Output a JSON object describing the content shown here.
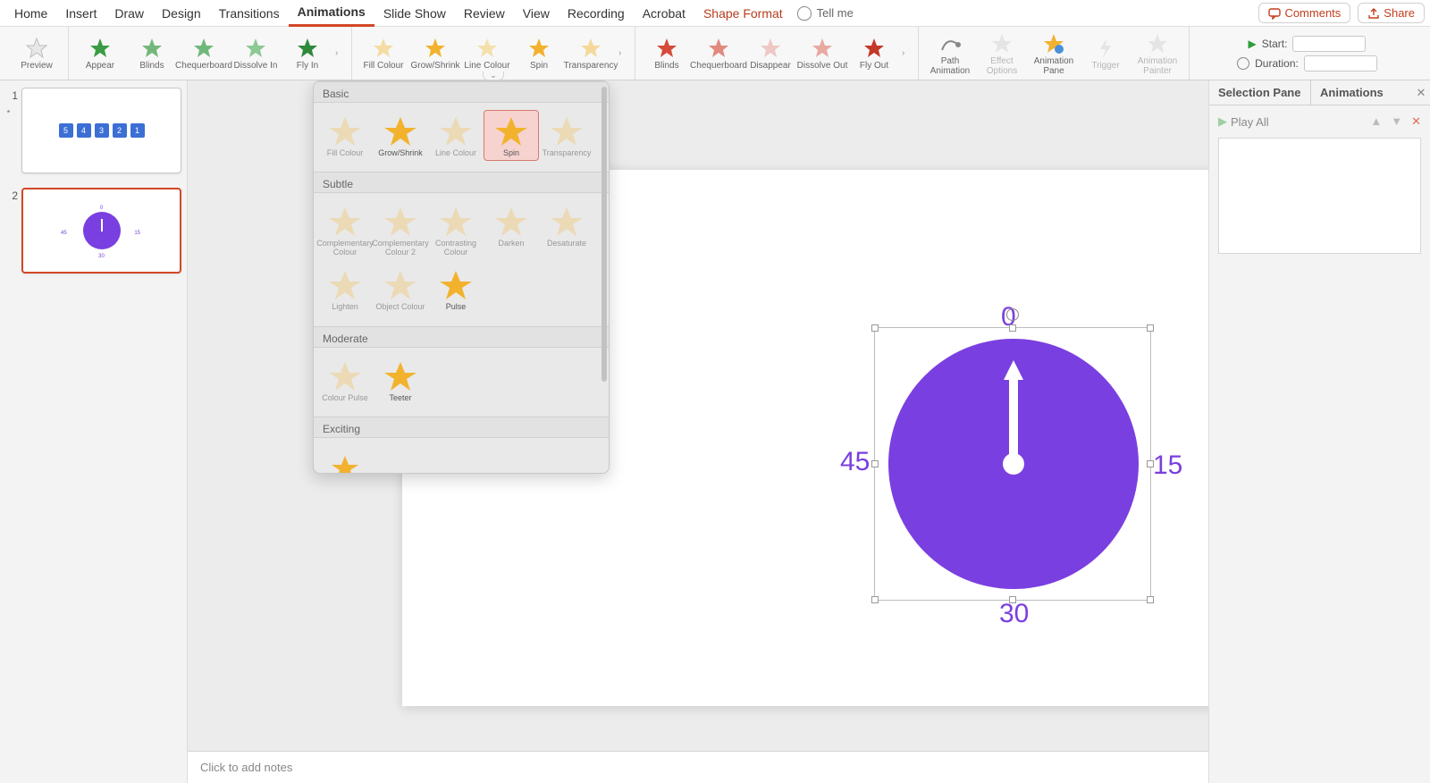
{
  "tabs": {
    "items": [
      "Home",
      "Insert",
      "Draw",
      "Design",
      "Transitions",
      "Animations",
      "Slide Show",
      "Review",
      "View",
      "Recording",
      "Acrobat"
    ],
    "active": "Animations",
    "shape": "Shape Format",
    "tellme": "Tell me",
    "comments": "Comments",
    "share": "Share"
  },
  "ribbon": {
    "preview": "Preview",
    "entrance": [
      "Appear",
      "Blinds",
      "Chequerboard",
      "Dissolve In",
      "Fly In"
    ],
    "emphasis": [
      "Fill Colour",
      "Grow/Shrink",
      "Line Colour",
      "Spin",
      "Transparency"
    ],
    "exit": [
      "Blinds",
      "Chequerboard",
      "Disappear",
      "Dissolve Out",
      "Fly Out"
    ],
    "adv": [
      {
        "l1": "Path",
        "l2": "Animation"
      },
      {
        "l1": "Effect",
        "l2": "Options"
      },
      {
        "l1": "Animation",
        "l2": "Pane"
      },
      {
        "l1": "Trigger",
        "l2": ""
      },
      {
        "l1": "Animation",
        "l2": "Painter"
      }
    ],
    "timing": {
      "start": "Start:",
      "duration": "Duration:",
      "start_val": "",
      "duration_val": ""
    }
  },
  "popover": {
    "sections": {
      "basic": "Basic",
      "subtle": "Subtle",
      "moderate": "Moderate",
      "exciting": "Exciting"
    },
    "basic": [
      "Fill Colour",
      "Grow/Shrink",
      "Line Colour",
      "Spin",
      "Transparency"
    ],
    "selected": "Spin",
    "subtle": [
      "Complementary Colour",
      "Complementary Colour 2",
      "Contrasting Colour",
      "Darken",
      "Desaturate",
      "Lighten",
      "Object Colour",
      "Pulse"
    ],
    "moderate": [
      "Colour Pulse",
      "Teeter"
    ]
  },
  "thumbs": {
    "n1": "1",
    "n2": "2",
    "slide1": [
      "5",
      "4",
      "3",
      "2",
      "1"
    ],
    "slide2": {
      "n0": "0",
      "n15": "15",
      "n30": "30",
      "n45": "45"
    },
    "ani_icon": "✦"
  },
  "canvas": {
    "clock": {
      "n0": "0",
      "n15": "15",
      "n30": "30",
      "n45": "45"
    }
  },
  "rpanel": {
    "sel": "Selection Pane",
    "anim": "Animations",
    "play": "Play All",
    "up": "▲",
    "down": "▼",
    "x": "✕"
  },
  "notes": "Click to add notes"
}
